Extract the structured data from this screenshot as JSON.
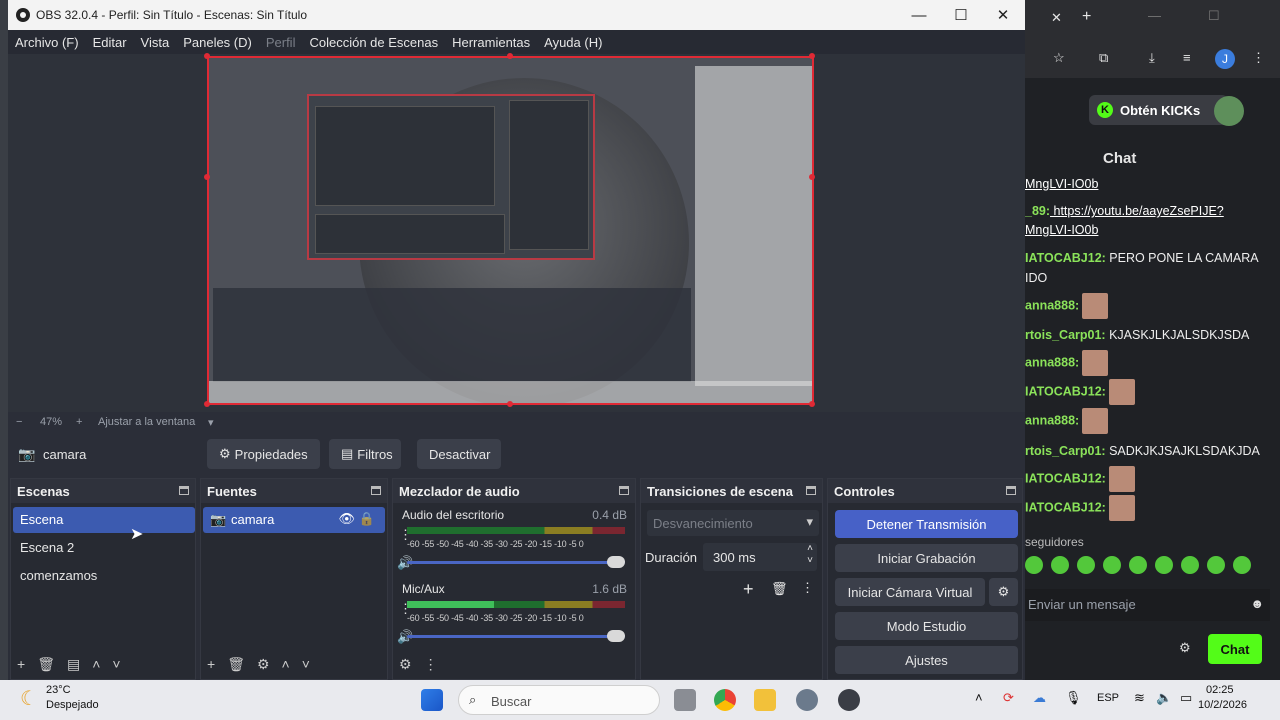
{
  "window": {
    "title": "OBS 32.0.4 - Perfil: Sin Título - Escenas: Sin Título",
    "controls": {
      "minimize": "—",
      "maximize": "☐",
      "close": "✕"
    }
  },
  "menu": [
    "Archivo (F)",
    "Editar",
    "Vista",
    "Paneles (D)",
    "Perfil",
    "Colección de Escenas",
    "Herramientas",
    "Ayuda (H)"
  ],
  "zoom": {
    "minus": "−",
    "level": "47%",
    "plus": "+",
    "fit_label": "Ajustar a la ventana"
  },
  "source_toolbar": {
    "current_source": "camara",
    "properties": "Propiedades",
    "filters": "Filtros",
    "deactivate": "Desactivar"
  },
  "scenes": {
    "title": "Escenas",
    "items": [
      "Escena",
      "Escena 2",
      "comenzamos"
    ],
    "selected_index": 0
  },
  "sources": {
    "title": "Fuentes",
    "items": [
      "camara"
    ]
  },
  "audio_mixer": {
    "title": "Mezclador de audio",
    "channels": [
      {
        "name": "Audio del escritorio",
        "db": "0.4 dB"
      },
      {
        "name": "Mic/Aux",
        "db": "1.6 dB"
      }
    ],
    "scale": "-60 -55 -50 -45 -40 -35 -30 -25 -20 -15 -10 -5 0"
  },
  "transitions": {
    "title": "Transiciones de escena",
    "type": "Desvanecimiento",
    "duration_label": "Duración",
    "duration_value": "300 ms"
  },
  "controls": {
    "title": "Controles",
    "stop_stream": "Detener Transmisión",
    "start_recording": "Iniciar Grabación",
    "start_virtual_cam": "Iniciar Cámara Virtual",
    "studio_mode": "Modo Estudio",
    "settings": "Ajustes"
  },
  "browser": {
    "kick_button": "Obtén KICKs",
    "chat_title": "Chat",
    "messages": [
      {
        "user": "",
        "text": "MngLVI-IO0b",
        "emotes": 0
      },
      {
        "user": "_89:",
        "text": " https://youtu.be/aayeZsePIJE?",
        "emotes": 0
      },
      {
        "user": "",
        "text": "MngLVI-IO0b",
        "emotes": 0
      },
      {
        "user": "IATOCABJ12:",
        "text": " PERO PONE LA CAMARA",
        "emotes": 0
      },
      {
        "user": "",
        "text": "IDO",
        "emotes": 0
      },
      {
        "user": "anna888:",
        "text": "",
        "emotes": 1
      },
      {
        "user": "rtois_Carp01:",
        "text": " KJASKJLKJALSDKJSDA",
        "emotes": 0
      },
      {
        "user": "anna888:",
        "text": "",
        "emotes": 1
      },
      {
        "user": "IATOCABJ12:",
        "text": "",
        "emotes": 1
      },
      {
        "user": "anna888:",
        "text": "",
        "emotes": 1
      },
      {
        "user": "rtois_Carp01:",
        "text": " SADKJKJSAJKLSDAKJDA",
        "emotes": 0
      },
      {
        "user": "IATOCABJ12:",
        "text": "",
        "emotes": 1
      },
      {
        "user": "IATOCABJ12:",
        "text": "",
        "emotes": 1
      }
    ],
    "followers_label": "seguidores",
    "input_placeholder": "Enviar un mensaje",
    "send_button": "Chat",
    "avatar_letter": "J"
  },
  "taskbar": {
    "weather_temp": "23°C",
    "weather_desc": "Despejado",
    "search_placeholder": "Buscar",
    "lang": "ESP",
    "time": "02:25",
    "date": "10/2/2026"
  }
}
